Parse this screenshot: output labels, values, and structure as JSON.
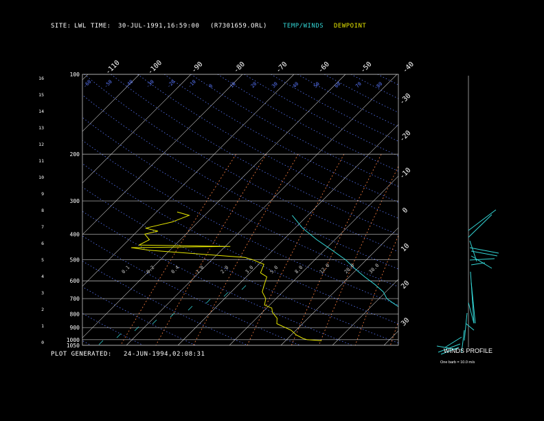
{
  "header": {
    "site_label": "SITE:",
    "site": "LWL",
    "time_label": "TIME:",
    "time": "30-JUL-1991,16:59:00",
    "file": "(R7301659.ORL)",
    "temp_winds_label": "TEMP/WINDS",
    "dewpoint_label": "DEWPOINT"
  },
  "footer": {
    "plot_generated_label": "PLOT GENERATED:",
    "plot_generated": "24-JUN-1994,02:08:31"
  },
  "colors": {
    "background": "#000000",
    "grid": "#c8c8c8",
    "temp": "#33d6d6",
    "dewpoint": "#e6e600",
    "dry_adiabat": "#5a78ff",
    "mixing_ratio": "#ff8040"
  },
  "chart_data": {
    "type": "line",
    "title": "",
    "pressure_levels_mb": [
      100,
      200,
      300,
      400,
      500,
      600,
      700,
      800,
      900,
      1000,
      1050
    ],
    "height_ticks_km": [
      "16",
      "15",
      "14",
      "13",
      "12",
      "11",
      "10",
      "9",
      "8",
      "7",
      "6",
      "5",
      "4",
      "3",
      "2",
      "1",
      "0"
    ],
    "temp_ticks_top": [
      "-110",
      "-100",
      "-90",
      "-80",
      "-70",
      "-60",
      "-50",
      "-40"
    ],
    "temp_ticks_right": [
      "-30",
      "-20",
      "-10",
      "0",
      "10",
      "20",
      "30"
    ],
    "dry_adiabat_labels": [
      "-60",
      "-50",
      "-40",
      "-30",
      "-20",
      "-10",
      "0",
      "10",
      "20",
      "30",
      "40",
      "50",
      "60",
      "70",
      "80"
    ],
    "mixing_ratio_labels": [
      "0.1",
      "0.2",
      "0.4",
      "1.0",
      "2.0",
      "3.0",
      "5.0",
      "8.0",
      "12.0",
      "20.0",
      "30.0"
    ],
    "series": [
      {
        "name": "TEMP/WINDS",
        "pressure": [
          340,
          380,
          420,
          460,
          500,
          540,
          580,
          620,
          660,
          700,
          740,
          780,
          820,
          860,
          900,
          940,
          980,
          1010
        ],
        "temperature": [
          -33,
          -28.5,
          -23.5,
          -18.5,
          -14,
          -10.5,
          -7,
          -3.5,
          -0.5,
          1.5,
          4.5,
          7.5,
          11,
          14.5,
          18,
          21,
          23.5,
          25
        ]
      },
      {
        "name": "DEWPOINT",
        "pressure": [
          330,
          340,
          360,
          380,
          390,
          400,
          420,
          440,
          445,
          450,
          460,
          490,
          500,
          520,
          560,
          580,
          620,
          660,
          700,
          740,
          760,
          790,
          830,
          870,
          920,
          960,
          990,
          1000,
          1008
        ],
        "dewpoint": [
          -56,
          -53,
          -55,
          -59,
          -56,
          -58,
          -56,
          -57,
          -39,
          -58,
          -54,
          -34,
          -32,
          -29,
          -28,
          -26,
          -25,
          -24,
          -22,
          -21,
          -19,
          -18,
          -16,
          -15,
          -11,
          -9,
          -7,
          -6,
          -3
        ]
      }
    ]
  },
  "winds_profile": {
    "label": "WINDS PROFILE",
    "scale": "One barb = 10.0 m/s"
  }
}
